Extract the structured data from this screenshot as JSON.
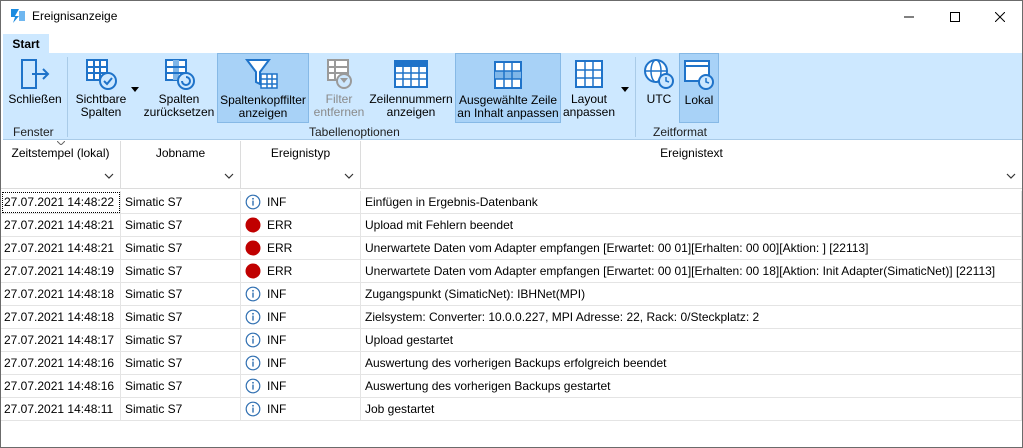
{
  "window": {
    "title": "Ereignisanzeige"
  },
  "ribbon": {
    "tab_label": "Start",
    "buttons": {
      "close": {
        "line1": "Schließen",
        "line2": ""
      },
      "visible_columns": {
        "line1": "Sichtbare",
        "line2": "Spalten"
      },
      "reset_columns": {
        "line1": "Spalten",
        "line2": "zurücksetzen"
      },
      "header_filter": {
        "line1": "Spaltenkopffilter",
        "line2": "anzeigen"
      },
      "remove_filter": {
        "line1": "Filter",
        "line2": "entfernen"
      },
      "row_numbers": {
        "line1": "Zeilennummern",
        "line2": "anzeigen"
      },
      "fit_row": {
        "line1": "Ausgewählte Zeile",
        "line2": "an Inhalt anpassen"
      },
      "layout": {
        "line1": "Layout",
        "line2": "anpassen"
      },
      "utc": {
        "line1": "UTC",
        "line2": ""
      },
      "local": {
        "line1": "Lokal",
        "line2": ""
      }
    },
    "groups": {
      "window": "Fenster",
      "table_options": "Tabellenoptionen",
      "time_format": "Zeitformat"
    }
  },
  "grid": {
    "columns": [
      "Zeitstempel (lokal)",
      "Jobname",
      "Ereignistyp",
      "Ereignistext"
    ],
    "rows": [
      {
        "ts": "27.07.2021 14:48:22",
        "job": "Simatic S7",
        "type": "INF",
        "text": "Einfügen in Ergebnis-Datenbank"
      },
      {
        "ts": "27.07.2021 14:48:21",
        "job": "Simatic S7",
        "type": "ERR",
        "text": "Upload mit Fehlern beendet"
      },
      {
        "ts": "27.07.2021 14:48:21",
        "job": "Simatic S7",
        "type": "ERR",
        "text": "Unerwartete Daten vom Adapter empfangen [Erwartet: 00 01][Erhalten: 00 00][Aktion: ] [22113]"
      },
      {
        "ts": "27.07.2021 14:48:19",
        "job": "Simatic S7",
        "type": "ERR",
        "text": "Unerwartete Daten vom Adapter empfangen [Erwartet: 00 01][Erhalten: 00 18][Aktion: Init Adapter(SimaticNet)] [22113]"
      },
      {
        "ts": "27.07.2021 14:48:18",
        "job": "Simatic S7",
        "type": "INF",
        "text": "Zugangspunkt (SimaticNet): IBHNet(MPI)"
      },
      {
        "ts": "27.07.2021 14:48:18",
        "job": "Simatic S7",
        "type": "INF",
        "text": "Zielsystem: Converter: 10.0.0.227, MPI Adresse: 22, Rack: 0/Steckplatz: 2"
      },
      {
        "ts": "27.07.2021 14:48:17",
        "job": "Simatic S7",
        "type": "INF",
        "text": "Upload gestartet"
      },
      {
        "ts": "27.07.2021 14:48:16",
        "job": "Simatic S7",
        "type": "INF",
        "text": "Auswertung des vorherigen Backups erfolgreich beendet"
      },
      {
        "ts": "27.07.2021 14:48:16",
        "job": "Simatic S7",
        "type": "INF",
        "text": "Auswertung des vorherigen Backups gestartet"
      },
      {
        "ts": "27.07.2021 14:48:11",
        "job": "Simatic S7",
        "type": "INF",
        "text": "Job gestartet"
      }
    ]
  },
  "colors": {
    "accent": "#1a73c8",
    "ribbon_bg": "#cde8ff",
    "error": "#c00000",
    "info": "#2f6fb1"
  }
}
